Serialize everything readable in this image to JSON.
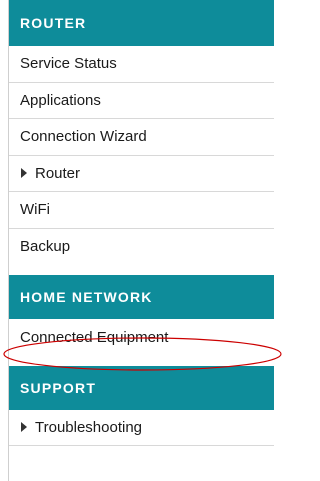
{
  "sections": [
    {
      "title": "ROUTER",
      "items": [
        {
          "label": "Service Status",
          "expandable": false
        },
        {
          "label": "Applications",
          "expandable": false
        },
        {
          "label": "Connection Wizard",
          "expandable": false
        },
        {
          "label": "Router",
          "expandable": true
        },
        {
          "label": "WiFi",
          "expandable": false
        },
        {
          "label": "Backup",
          "expandable": false
        }
      ]
    },
    {
      "title": "HOME NETWORK",
      "items": [
        {
          "label": "Connected Equipment",
          "expandable": false,
          "highlighted": true
        }
      ]
    },
    {
      "title": "SUPPORT",
      "items": [
        {
          "label": "Troubleshooting",
          "expandable": true
        }
      ]
    }
  ],
  "colors": {
    "header_bg": "#0e8c9a",
    "highlight_ellipse": "#cc0000"
  }
}
